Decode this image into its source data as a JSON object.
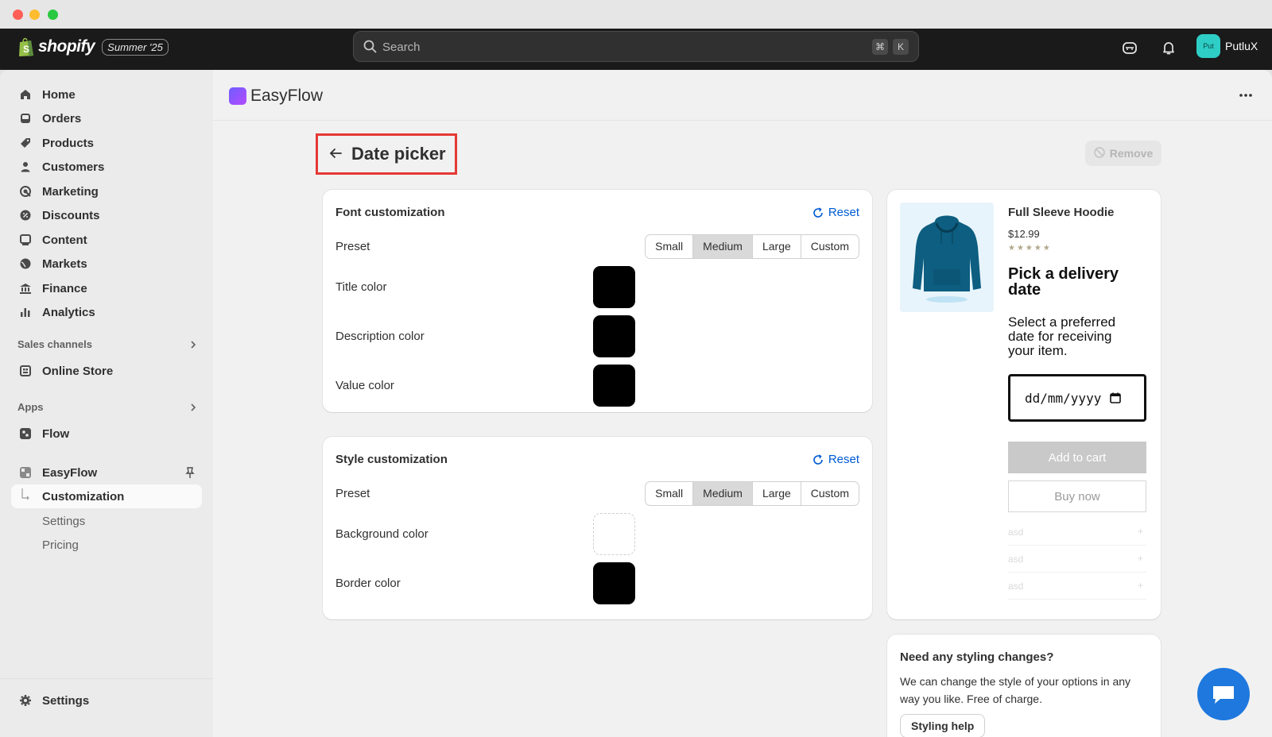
{
  "window": {
    "traffic_lights": [
      "close",
      "minimize",
      "zoom"
    ]
  },
  "topbar": {
    "brand": "shopify",
    "edition": "Summer '25",
    "search_placeholder": "Search",
    "shortcut_cmd": "⌘",
    "shortcut_key": "K",
    "avatar_initials": "Put",
    "store_name": "PutluX",
    "icons": [
      "shop-assistant-icon",
      "bell-icon"
    ]
  },
  "sidebar": {
    "main_items": [
      {
        "label": "Home",
        "icon": "home-icon"
      },
      {
        "label": "Orders",
        "icon": "inbox-icon"
      },
      {
        "label": "Products",
        "icon": "tag-icon"
      },
      {
        "label": "Customers",
        "icon": "person-icon"
      },
      {
        "label": "Marketing",
        "icon": "target-icon"
      },
      {
        "label": "Discounts",
        "icon": "discount-icon"
      },
      {
        "label": "Content",
        "icon": "content-icon"
      },
      {
        "label": "Markets",
        "icon": "globe-icon"
      },
      {
        "label": "Finance",
        "icon": "bank-icon"
      },
      {
        "label": "Analytics",
        "icon": "chart-icon"
      }
    ],
    "sales_channels_heading": "Sales channels",
    "online_store": "Online Store",
    "apps_heading": "Apps",
    "flow": "Flow",
    "easyflow": "EasyFlow",
    "easyflow_sub": [
      "Customization",
      "Settings",
      "Pricing"
    ],
    "settings": "Settings"
  },
  "app": {
    "name": "EasyFlow",
    "page_title": "Date picker",
    "remove_label": "Remove"
  },
  "font_card": {
    "title": "Font customization",
    "reset": "Reset",
    "preset_label": "Preset",
    "presets": [
      "Small",
      "Medium",
      "Large",
      "Custom"
    ],
    "selected_preset": "Medium",
    "rows": [
      {
        "label": "Title color",
        "color": "#000000"
      },
      {
        "label": "Description color",
        "color": "#000000"
      },
      {
        "label": "Value color",
        "color": "#000000"
      }
    ]
  },
  "style_card": {
    "title": "Style customization",
    "reset": "Reset",
    "preset_label": "Preset",
    "presets": [
      "Small",
      "Medium",
      "Large",
      "Custom"
    ],
    "selected_preset": "Medium",
    "rows": [
      {
        "label": "Background color",
        "color": "#ffffff"
      },
      {
        "label": "Border color",
        "color": "#000000"
      }
    ]
  },
  "preview": {
    "product_name": "Full Sleeve Hoodie",
    "price": "$12.99",
    "rating_stars": 5,
    "title": "Pick a delivery date",
    "description": "Select a preferred date for receiving your item.",
    "date_placeholder": "dd/mm/yyyy",
    "add_to_cart": "Add to cart",
    "buy_now": "Buy now",
    "accordion": [
      "asd",
      "asd",
      "asd"
    ],
    "accordion_symbol": "+"
  },
  "help": {
    "title": "Need any styling changes?",
    "text": "We can change the style of your options in any way you like. Free of charge.",
    "button": "Styling help"
  },
  "colors": {
    "accent": "#005bd3",
    "highlight_border": "#e53935",
    "chat": "#1e78de"
  }
}
